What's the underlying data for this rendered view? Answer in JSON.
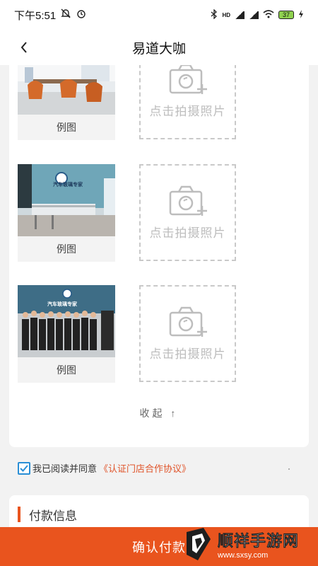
{
  "status_bar": {
    "time": "下午5:51",
    "network_label": "HD",
    "battery_level": "37"
  },
  "nav": {
    "title": "易道大咖"
  },
  "examples": [
    {
      "label": "例图",
      "upload_text": "点击拍摄照片"
    },
    {
      "label": "例图",
      "upload_text": "点击拍摄照片",
      "photo_sign": "汽车玻璃专家"
    },
    {
      "label": "例图",
      "upload_text": "点击拍摄照片",
      "photo_sign": "汽车玻璃专家"
    }
  ],
  "collapse_label": "收起 ↑",
  "agreement": {
    "checked": true,
    "text": "我已阅读并同意",
    "link": "《认证门店合作协议》"
  },
  "payment": {
    "title": "付款信息"
  },
  "confirm_button": {
    "label": "确认付款"
  },
  "watermark": {
    "title": "顺祥手游网",
    "url": "www.sxsy.com"
  },
  "colors": {
    "accent": "#e9541e",
    "link": "#e0542a",
    "checkbox": "#2a8fd6"
  }
}
